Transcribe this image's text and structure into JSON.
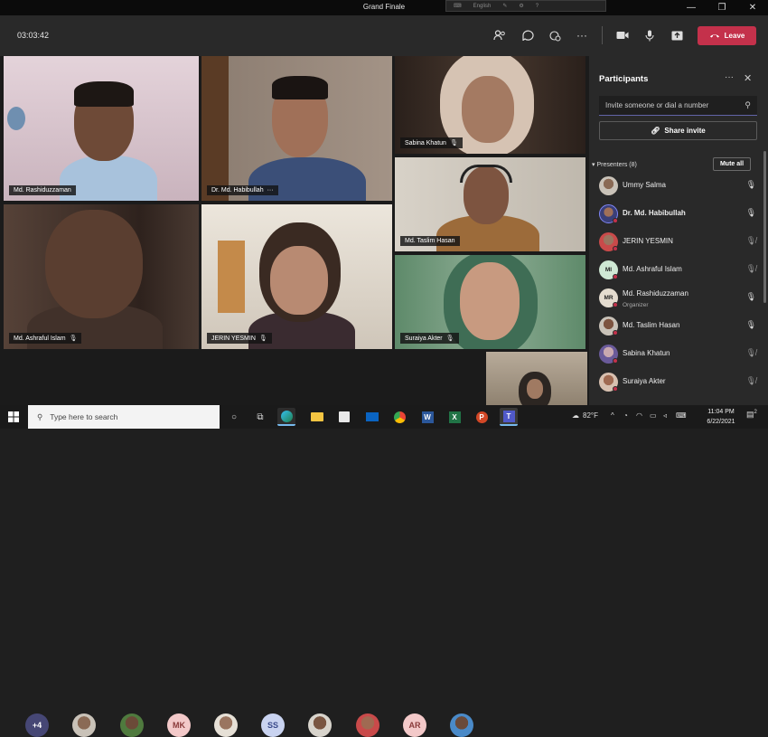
{
  "window": {
    "title": "Grand Finale",
    "lang": "English",
    "min": "—",
    "max": "❐",
    "close": "✕"
  },
  "meeting": {
    "timer": "03:03:42",
    "leave_label": "Leave",
    "icons": [
      "people-icon",
      "chat-icon",
      "reactions-icon",
      "more-icon",
      "camera-icon",
      "mic-icon",
      "share-screen-icon"
    ]
  },
  "tiles": [
    {
      "name": "Md. Rashiduzzaman",
      "muted": false
    },
    {
      "name": "Dr. Md. Habibullah",
      "muted": false,
      "more": "···"
    },
    {
      "name": "Sabina Khatun",
      "muted": true
    },
    {
      "name": "Md. Taslim Hasan",
      "muted": false
    },
    {
      "name": "Md. Ashraful Islam",
      "muted": true
    },
    {
      "name": "JERIN YESMIN",
      "muted": true
    },
    {
      "name": "Suraiya Akter",
      "muted": true
    }
  ],
  "strip": {
    "overflow": "+4",
    "initials": [
      "MK",
      "SS",
      "AR"
    ]
  },
  "panel": {
    "title": "Participants",
    "more": "···",
    "close": "✕",
    "invite_placeholder": "Invite someone or dial a number",
    "share_label": "Share invite",
    "section_label": "Presenters (8)",
    "mute_all": "Mute all",
    "people": [
      {
        "name": "Ummy Salma",
        "role": "",
        "bold": false,
        "muted": false,
        "initials": ""
      },
      {
        "name": "Dr. Md. Habibullah",
        "role": "",
        "bold": true,
        "muted": false,
        "initials": ""
      },
      {
        "name": "JERIN YESMIN",
        "role": "",
        "bold": false,
        "muted": true,
        "initials": ""
      },
      {
        "name": "Md. Ashraful Islam",
        "role": "",
        "bold": false,
        "muted": true,
        "initials": "MI"
      },
      {
        "name": "Md. Rashiduzzaman",
        "role": "Organizer",
        "bold": false,
        "muted": true,
        "initials": "MR"
      },
      {
        "name": "Md. Taslim Hasan",
        "role": "",
        "bold": false,
        "muted": false,
        "initials": ""
      },
      {
        "name": "Sabina Khatun",
        "role": "",
        "bold": false,
        "muted": true,
        "initials": ""
      },
      {
        "name": "Suraiya Akter",
        "role": "",
        "bold": false,
        "muted": true,
        "initials": ""
      }
    ]
  },
  "taskbar": {
    "search_placeholder": "Type here to search",
    "temperature": "82°F",
    "time": "11:04 PM",
    "date": "6/22/2021",
    "notif": "2"
  },
  "colors": {
    "leave": "#c4314b",
    "accent": "#6264a7"
  }
}
